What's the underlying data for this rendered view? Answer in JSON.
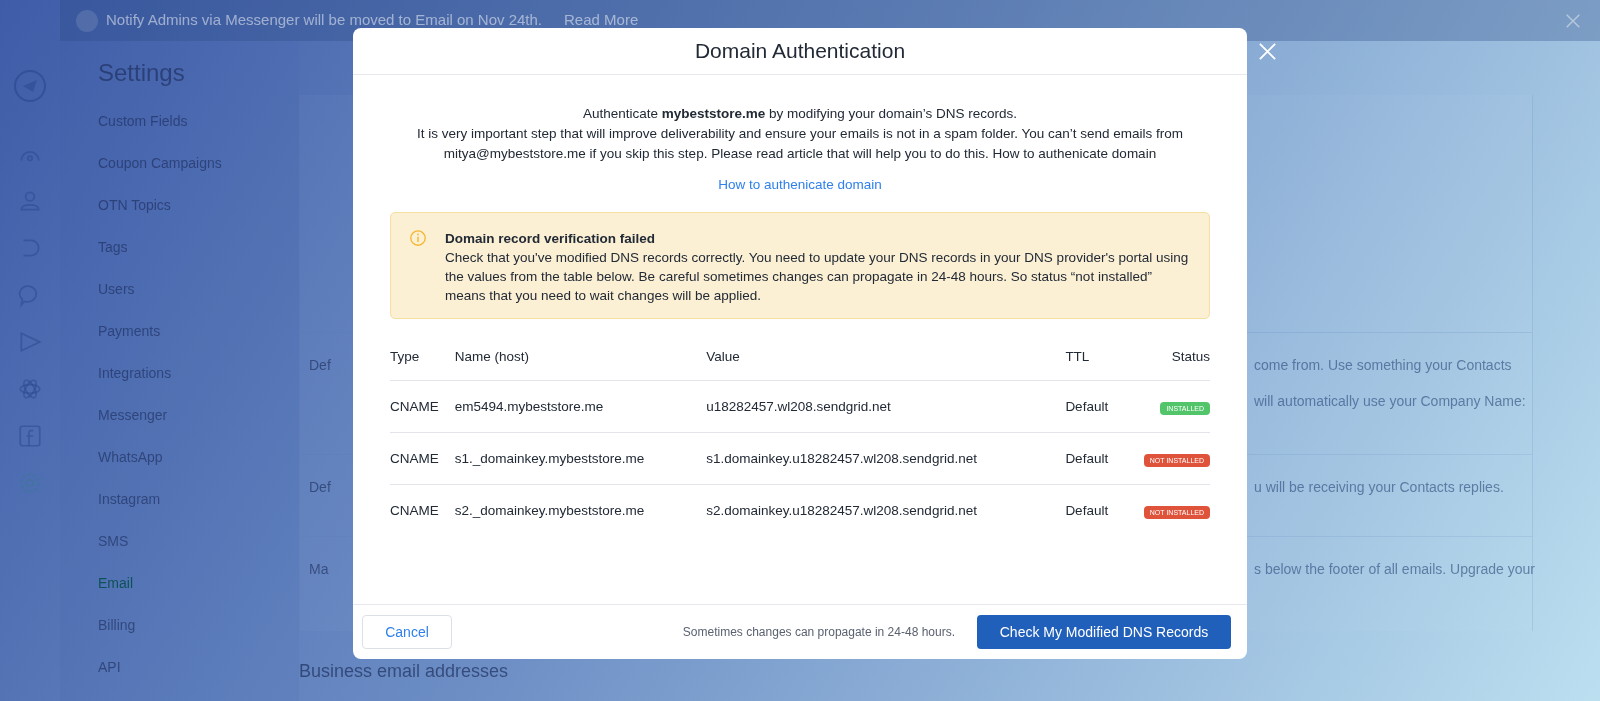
{
  "banner": {
    "text": "Notify Admins via Messenger will be moved to Email on Nov 24th.",
    "link": "Read More"
  },
  "page_title": "Settings",
  "sidebar": {
    "items": [
      {
        "label": "Custom Fields",
        "selected": false
      },
      {
        "label": "Coupon Campaigns",
        "selected": false
      },
      {
        "label": "OTN Topics",
        "selected": false
      },
      {
        "label": "Tags",
        "selected": false
      },
      {
        "label": "Users",
        "selected": false
      },
      {
        "label": "Payments",
        "selected": false
      },
      {
        "label": "Integrations",
        "selected": false
      },
      {
        "label": "Messenger",
        "selected": false
      },
      {
        "label": "WhatsApp",
        "selected": false
      },
      {
        "label": "Instagram",
        "selected": false
      },
      {
        "label": "SMS",
        "selected": false
      },
      {
        "label": "Email",
        "selected": true
      },
      {
        "label": "Billing",
        "selected": false
      },
      {
        "label": "API",
        "selected": false
      }
    ]
  },
  "settings_rows": [
    {
      "label": "Def",
      "lines": [
        "come from. Use something your Contacts",
        "will automatically use your Company Name:"
      ]
    },
    {
      "label": "Def",
      "lines": [
        "u will be receiving your Contacts replies."
      ]
    },
    {
      "label": "Ma",
      "lines": [
        "s below the footer of all emails. Upgrade your"
      ]
    }
  ],
  "section_heading": "Business email addresses",
  "modal": {
    "title": "Domain Authentication",
    "intro": "Authenticate **mybeststore.me** by modifying your domain’s DNS records.",
    "description": "It is very important step that will improve deliverability and ensure your emails is not in a spam folder. You can’t send emails from mitya@mybeststore.me if you skip this step. Please read article that will help you to do this. How to authenicate domain",
    "help_link": "How to authenicate domain",
    "alert": {
      "title": "Domain record verification failed",
      "body": "Check that you've modified DNS records correctly. You need to update your DNS records in your DNS provider's portal using the values from the table below. Be careful sometimes changes can propagate in 24-48 hours. So status “not installed” means that you need to wait changes will be applied."
    },
    "table": {
      "columns": [
        "Type",
        "Name (host)",
        "Value",
        "TTL",
        "Status"
      ],
      "rows": [
        {
          "type": "CNAME",
          "host": "em5494.mybeststore.me",
          "value": "u18282457.wl208.sendgrid.net",
          "ttl": "Default",
          "status": "INSTALLED",
          "installed": true
        },
        {
          "type": "CNAME",
          "host": "s1._domainkey.mybeststore.me",
          "value": "s1.domainkey.u18282457.wl208.sendgrid.net",
          "ttl": "Default",
          "status": "NOT INSTALLED",
          "installed": false
        },
        {
          "type": "CNAME",
          "host": "s2._domainkey.mybeststore.me",
          "value": "s2.domainkey.u18282457.wl208.sendgrid.net",
          "ttl": "Default",
          "status": "NOT INSTALLED",
          "installed": false
        }
      ]
    },
    "cancel_button": "Cancel",
    "footer_note": "Sometimes changes can propagate in 24-48 hours.",
    "primary_button": "Check My Modified DNS Records"
  }
}
